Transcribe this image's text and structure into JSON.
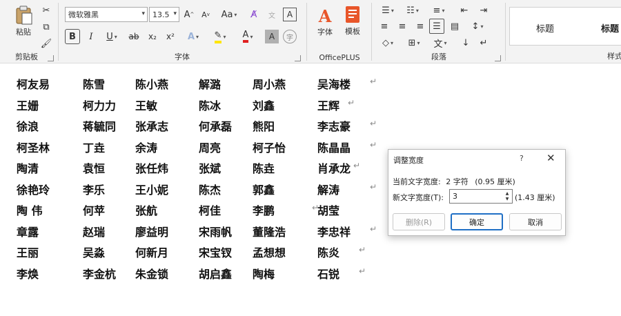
{
  "ribbon": {
    "clipboard": {
      "paste_label": "粘贴",
      "group_label": "剪贴板"
    },
    "font": {
      "font_name": "微软雅黑",
      "font_size": "13.5",
      "grow_label": "A",
      "shrink_label": "A",
      "case_label": "Aa",
      "bold": "B",
      "italic": "I",
      "underline": "U",
      "strike": "ab",
      "subscript": "x₂",
      "superscript": "x²",
      "text_effect": "A",
      "font_color": "A",
      "char_shading": "A",
      "enclose": "字",
      "group_label": "字体",
      "highlight_color": "#ffe600",
      "font_color_value": "#e02020"
    },
    "officeplus": {
      "font_label": "字体",
      "template_label": "模板",
      "group_label": "OfficePLUS"
    },
    "paragraph": {
      "group_label": "段落"
    },
    "styles": {
      "item1": "标题",
      "item2": "标题",
      "group_label": "样式"
    }
  },
  "document": {
    "paragraph_mark": "↵",
    "rows": [
      [
        "柯友易",
        "陈雪",
        "陈小燕",
        "解潞",
        "周小燕",
        "吴海楼"
      ],
      [
        "王姗",
        "柯力力",
        "王敏",
        "陈冰",
        "刘鑫",
        "王辉"
      ],
      [
        "徐浪",
        "蒋毓同",
        "张承志",
        "何承磊",
        "熊阳",
        "李志豪"
      ],
      [
        "柯圣林",
        "丁垚",
        "余涛",
        "周亮",
        "柯子怡",
        "陈晶晶"
      ],
      [
        "陶清",
        "袁恒",
        "张任炜",
        "张斌",
        "陈垚",
        "肖承龙"
      ],
      [
        "徐艳玲",
        "李乐",
        "王小妮",
        "陈杰",
        "郭鑫",
        "解涛"
      ],
      [
        "陶 伟",
        "何苹",
        "张航",
        "柯佳",
        "李鹏",
        "胡莹"
      ],
      [
        "章露",
        "赵瑞",
        "廖益明",
        "宋雨帆",
        "董隆浩",
        "李忠祥"
      ],
      [
        "王丽",
        "吴淼",
        "何新月",
        "宋宝钗",
        "孟想想",
        "陈炎"
      ],
      [
        "李焕",
        "李金杭",
        "朱金锁",
        "胡启鑫",
        "陶梅",
        "石锐"
      ]
    ]
  },
  "dialog": {
    "title": "调整宽度",
    "help": "?",
    "close": "✕",
    "current_label": "当前文字宽度:",
    "current_value": "2 字符",
    "current_cm": "(0.95 厘米)",
    "new_label": "新文字宽度(T):",
    "new_value": "3",
    "new_cm": "(1.43 厘米)",
    "delete_button": "删除(R)",
    "ok_button": "确定",
    "cancel_button": "取消"
  }
}
